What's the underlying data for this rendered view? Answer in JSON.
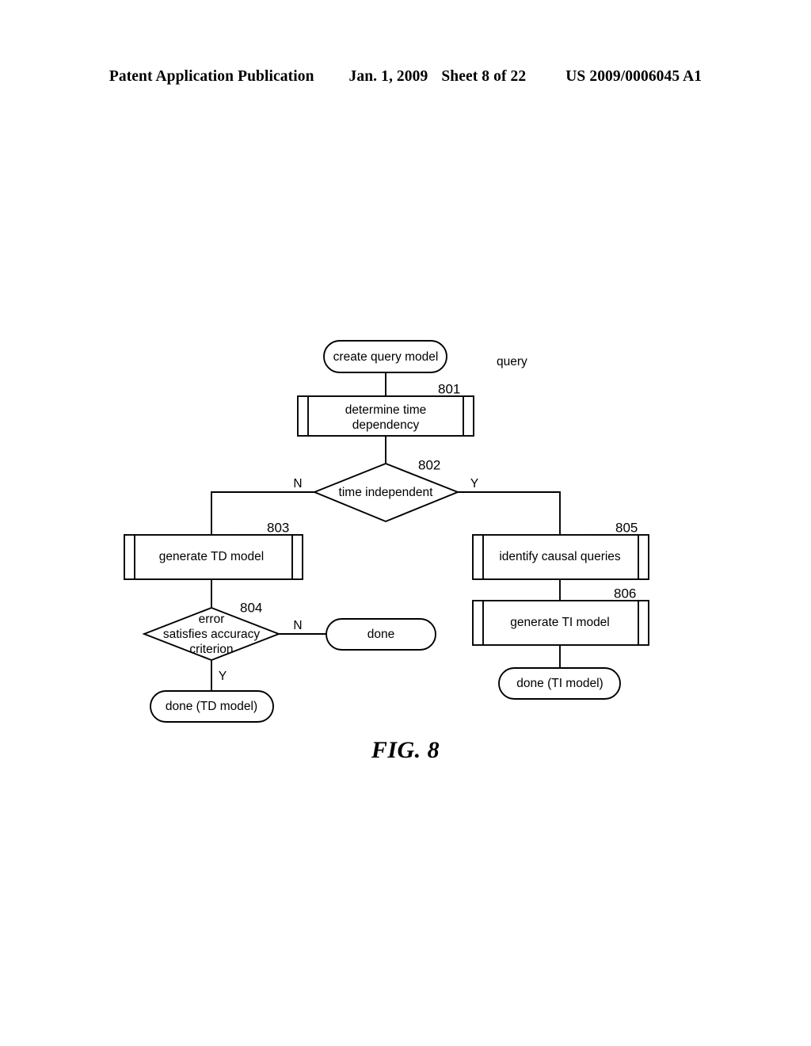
{
  "page": {
    "header": {
      "publication": "Patent Application Publication",
      "date": "Jan. 1, 2009",
      "sheet": "Sheet 8 of 22",
      "document_number": "US 2009/0006045 A1"
    },
    "figure_caption": "FIG. 8",
    "background_color": "#ffffff",
    "line_color": "#000000"
  },
  "figure": {
    "free_labels": [
      {
        "text": "query"
      }
    ],
    "nodes": [
      {
        "id": "create-query-model",
        "shape": "terminator",
        "label": "create query model",
        "ref": null
      },
      {
        "id": "determine-time-dependency",
        "shape": "predefined-process",
        "label_line1": "determine time",
        "label_line2": "dependency",
        "ref": "801"
      },
      {
        "id": "time-independent",
        "shape": "decision",
        "label": "time independent",
        "ref": "802",
        "branch_no": "N",
        "branch_yes": "Y"
      },
      {
        "id": "generate-td-model",
        "shape": "predefined-process",
        "label": "generate TD model",
        "ref": "803"
      },
      {
        "id": "error-satisfies-accuracy-criterion",
        "shape": "decision",
        "label_line1": "error",
        "label_line2": "satisfies accuracy",
        "label_line3": "criterion",
        "ref": "804",
        "branch_no": "N",
        "branch_yes": "Y"
      },
      {
        "id": "done",
        "shape": "terminator",
        "label": "done",
        "ref": null
      },
      {
        "id": "done-td-model",
        "shape": "terminator",
        "label": "done (TD model)",
        "ref": null
      },
      {
        "id": "identify-causal-queries",
        "shape": "predefined-process",
        "label": "identify causal queries",
        "ref": "805"
      },
      {
        "id": "generate-ti-model",
        "shape": "predefined-process",
        "label": "generate TI model",
        "ref": "806"
      },
      {
        "id": "done-ti-model",
        "shape": "terminator",
        "label": "done (TI model)",
        "ref": null
      }
    ]
  }
}
